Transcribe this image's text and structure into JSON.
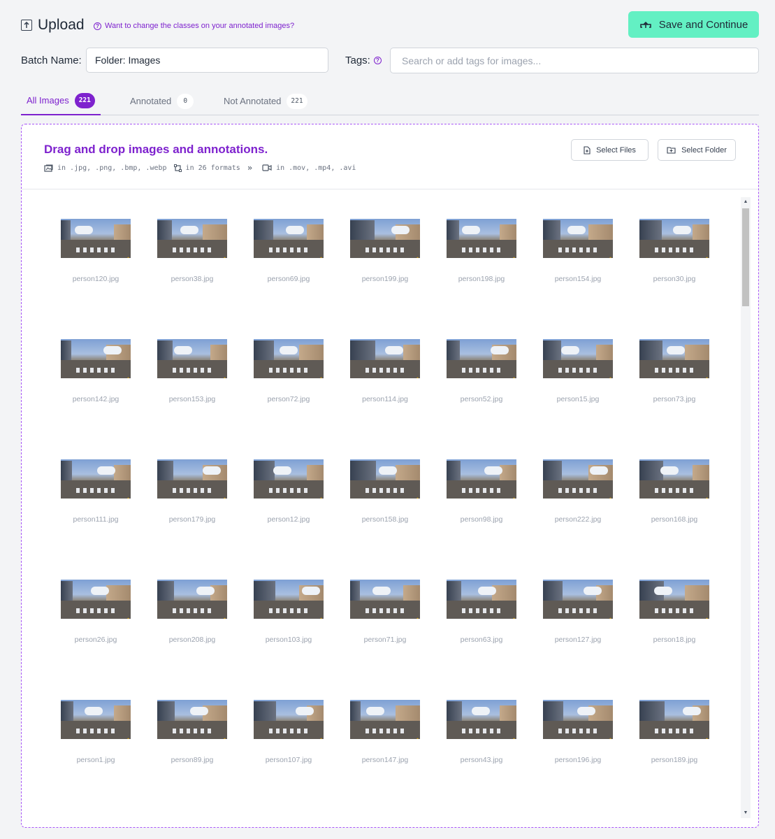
{
  "header": {
    "title": "Upload",
    "help_link": "Want to change the classes on your annotated images?",
    "save_button": "Save and Continue"
  },
  "batch": {
    "label": "Batch Name:",
    "value": "Folder: Images"
  },
  "tags": {
    "label": "Tags:",
    "placeholder": "Search or add tags for images..."
  },
  "tabs": [
    {
      "label": "All Images",
      "count": "221",
      "active": true
    },
    {
      "label": "Annotated",
      "count": "0",
      "active": false
    },
    {
      "label": "Not Annotated",
      "count": "221",
      "active": false
    }
  ],
  "dropzone": {
    "title": "Drag and drop images and annotations.",
    "image_formats": "in .jpg, .png, .bmp, .webp",
    "annotation_formats": "in 26 formats",
    "video_formats": "in .mov, .mp4, .avi",
    "select_files": "Select Files",
    "select_folder": "Select Folder"
  },
  "images": [
    "person120.jpg",
    "person38.jpg",
    "person69.jpg",
    "person199.jpg",
    "person198.jpg",
    "person154.jpg",
    "person30.jpg",
    "person142.jpg",
    "person153.jpg",
    "person72.jpg",
    "person114.jpg",
    "person52.jpg",
    "person15.jpg",
    "person73.jpg",
    "person111.jpg",
    "person179.jpg",
    "person12.jpg",
    "person158.jpg",
    "person98.jpg",
    "person222.jpg",
    "person168.jpg",
    "person26.jpg",
    "person208.jpg",
    "person103.jpg",
    "person71.jpg",
    "person63.jpg",
    "person127.jpg",
    "person18.jpg",
    "person1.jpg",
    "person89.jpg",
    "person107.jpg",
    "person147.jpg",
    "person43.jpg",
    "person196.jpg",
    "person189.jpg"
  ],
  "colors": {
    "accent": "#7e22ce",
    "save_button": "#63f0c3"
  }
}
